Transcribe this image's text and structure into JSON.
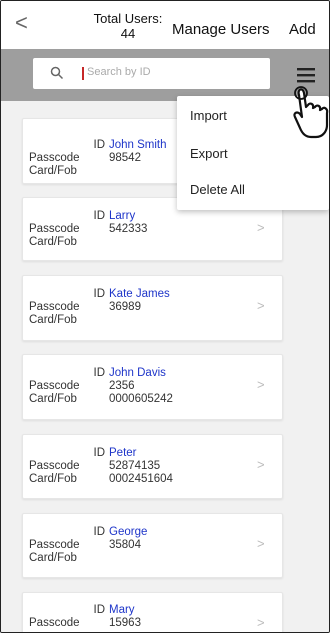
{
  "header": {
    "back_glyph": "<",
    "total_users_label": "Total Users:",
    "total_users_count": "44",
    "title": "Manage Users",
    "add_label": "Add"
  },
  "search": {
    "placeholder": "Search by ID",
    "icon": "search-icon"
  },
  "menu": {
    "icon": "hamburger-menu-icon",
    "items": [
      "Import",
      "Export",
      "Delete All"
    ]
  },
  "labels": {
    "id": "ID",
    "passcode": "Passcode",
    "cardfob": "Card/Fob"
  },
  "users": [
    {
      "id": "John Smith",
      "passcode": "98542",
      "cardfob": ""
    },
    {
      "id": "Larry",
      "passcode": "542333",
      "cardfob": ""
    },
    {
      "id": "Kate James",
      "passcode": "36989",
      "cardfob": ""
    },
    {
      "id": "John Davis",
      "passcode": "2356",
      "cardfob": "0000605242"
    },
    {
      "id": "Peter",
      "passcode": "52874135",
      "cardfob": "0002451604"
    },
    {
      "id": "George",
      "passcode": "35804",
      "cardfob": ""
    },
    {
      "id": "Mary",
      "passcode": "15963",
      "cardfob": ""
    }
  ],
  "colors": {
    "accent_name": "#1e35c9",
    "search_bar_bg": "#9e9e9e",
    "caret": "#c62828"
  }
}
